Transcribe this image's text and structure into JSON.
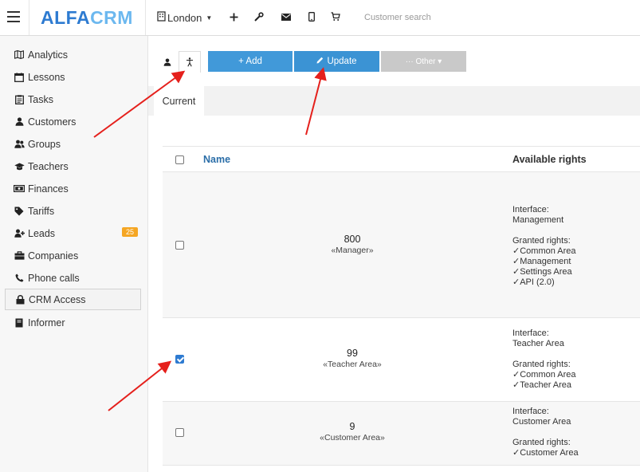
{
  "brand": {
    "part1": "ALFA",
    "part2": "CRM"
  },
  "header": {
    "branch": "London",
    "search_placeholder": "Customer search",
    "icons": [
      "plus-icon",
      "wrench-icon",
      "envelope-icon",
      "mobile-icon",
      "cart-icon"
    ]
  },
  "sidebar": {
    "items": [
      {
        "label": "Analytics",
        "icon": "map-icon"
      },
      {
        "label": "Lessons",
        "icon": "calendar-icon"
      },
      {
        "label": "Tasks",
        "icon": "clipboard-icon"
      },
      {
        "label": "Customers",
        "icon": "user-icon"
      },
      {
        "label": "Groups",
        "icon": "users-icon"
      },
      {
        "label": "Teachers",
        "icon": "graduation-cap-icon"
      },
      {
        "label": "Finances",
        "icon": "money-icon"
      },
      {
        "label": "Tariffs",
        "icon": "tag-icon"
      },
      {
        "label": "Leads",
        "icon": "user-plus-icon",
        "badge": "25"
      },
      {
        "label": "Companies",
        "icon": "briefcase-icon"
      },
      {
        "label": "Phone calls",
        "icon": "phone-icon"
      },
      {
        "label": "CRM Access",
        "icon": "lock-icon",
        "active": true
      },
      {
        "label": "Informer",
        "icon": "book-icon"
      }
    ]
  },
  "toolbar": {
    "add_label": "+ Add",
    "update_label": "Update",
    "other_label": "··· Other ▾"
  },
  "tabs": [
    {
      "label": "Current"
    }
  ],
  "table": {
    "headers": {
      "name": "Name",
      "rights": "Available rights"
    },
    "rows": [
      {
        "code": "800",
        "name": "«Manager»",
        "checked": false,
        "interface_label": "Interface:",
        "interface": "Management",
        "granted_label": "Granted rights:",
        "rights": [
          "✓Common Area",
          "✓Management",
          "✓Settings Area",
          "✓API (2.0)"
        ]
      },
      {
        "code": "99",
        "name": "«Teacher Area»",
        "checked": true,
        "interface_label": "Interface:",
        "interface": "Teacher Area",
        "granted_label": "Granted rights:",
        "rights": [
          "✓Common Area",
          "✓Teacher Area"
        ]
      },
      {
        "code": "9",
        "name": "«Customer Area»",
        "checked": false,
        "interface_label": "Interface:",
        "interface": "Customer Area",
        "granted_label": "Granted rights:",
        "rights": [
          "✓Customer Area"
        ]
      }
    ]
  },
  "colors": {
    "primary": "#3b93d4",
    "disabled": "#c9c9c9",
    "badge": "#f5a623",
    "annotation_arrow": "#e5201c"
  }
}
